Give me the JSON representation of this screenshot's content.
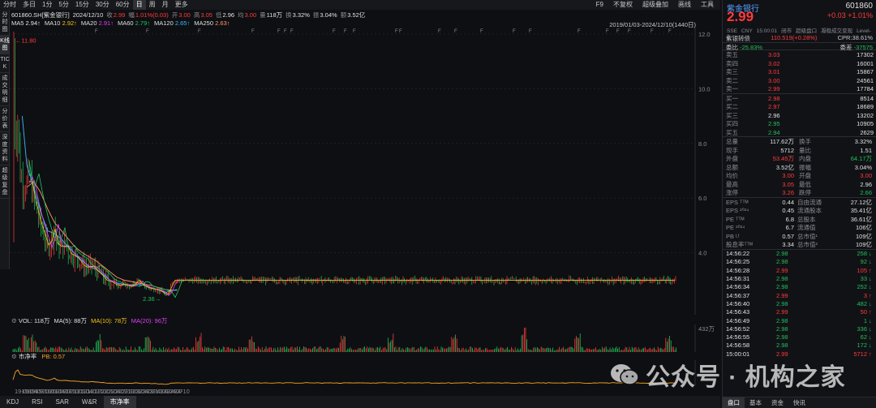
{
  "toolbar": {
    "items": [
      "分时",
      "多日",
      "1分",
      "5分",
      "15分",
      "30分",
      "60分",
      "日",
      "周",
      "月",
      "更多"
    ],
    "active": "日",
    "right": [
      "F9",
      "不复权",
      "超级叠加",
      "画线",
      "工具"
    ]
  },
  "leftbar": [
    "分时图",
    "K线图",
    "TICK",
    "成交明细",
    "分价表",
    "深度资料",
    "超级复盘"
  ],
  "info": {
    "symbol": "601860.SH[紫金银行]",
    "date": "2024/12/10",
    "close_label": "收",
    "close": "2.99",
    "change_label": "幅",
    "change": "1.01%(0.03)",
    "open_label": "开",
    "open": "3.00",
    "high_label": "高",
    "high": "3.05",
    "low_label": "低",
    "low": "2.96",
    "avg_label": "均",
    "avg": "3.00",
    "volume_label": "量",
    "volume": "118万",
    "turnover_label": "换",
    "turnover": "3.32%",
    "amplitude_label": "振",
    "amplitude": "3.04%",
    "amount_label": "额",
    "amount": "3.52亿"
  },
  "ma": [
    {
      "label": "MA5",
      "value": "2.94",
      "color": "#e8e8e8"
    },
    {
      "label": "MA10",
      "value": "2.92",
      "color": "#f5c518"
    },
    {
      "label": "MA20",
      "value": "2.91",
      "color": "#e040fb"
    },
    {
      "label": "MA60",
      "value": "2.79",
      "color": "#21c45e"
    },
    {
      "label": "MA120",
      "value": "2.65",
      "color": "#3db8ff"
    },
    {
      "label": "MA250",
      "value": "2.63",
      "color": "#ff9966"
    }
  ],
  "range_label": "2019/01/03-2024/12/10(1440日)",
  "annotations": {
    "high": "11.80",
    "low": "2.36"
  },
  "vol": {
    "header": "VOL: 118万",
    "ma5": "MA(5): 88万",
    "ma10": "MA(10): 78万",
    "ma20": "MA(20): 96万",
    "axis_max": "432万"
  },
  "pb": {
    "header": "市净率",
    "value": "PB: 0.57"
  },
  "bottom_tabs": [
    "KDJ",
    "RSI",
    "SAR",
    "W&R",
    "市净率"
  ],
  "bottom_active": "市净率",
  "colors": {
    "up": "#ff3b3b",
    "down": "#20c05a",
    "accent": "#5aa0ff"
  },
  "chart_data": {
    "type": "line",
    "title": "",
    "x": [
      "19-07",
      "19-10",
      "20-01",
      "20-04",
      "20-07",
      "20-10",
      "21-01",
      "21-04",
      "21-07",
      "21-10",
      "22-01",
      "22-04",
      "22-07",
      "22-10",
      "23-01",
      "23-04",
      "23-07",
      "23-10",
      "24-01",
      "24-04",
      "24-07",
      "24-10"
    ],
    "x_ticks": [
      "19-01",
      "19-04",
      "19-07",
      "19-10",
      "20-01",
      "20-04",
      "20-07",
      "20-10",
      "21-01",
      "21-04",
      "21-07",
      "21-10",
      "22-01",
      "22-04",
      "22-07",
      "22-10",
      "23-01",
      "23-04",
      "23-07",
      "23-10",
      "24-01",
      "24-04",
      "24-07",
      "24-10"
    ],
    "y_ticks": [
      "12.0",
      "10.0",
      "8.0",
      "6.0",
      "4.0"
    ],
    "ylim": [
      2.0,
      12.0
    ],
    "price_points": [
      [
        "19-01",
        4.5
      ],
      [
        "19-01b",
        11.8
      ],
      [
        "19-02",
        8.0
      ],
      [
        "19-03",
        9.0
      ],
      [
        "19-04",
        7.0
      ],
      [
        "19-05",
        6.6
      ],
      [
        "19-07",
        6.5
      ],
      [
        "19-08",
        6.9
      ],
      [
        "19-10",
        6.0
      ],
      [
        "19-12",
        5.3
      ],
      [
        "20-01",
        5.0
      ],
      [
        "20-03",
        4.5
      ],
      [
        "20-04",
        4.2
      ],
      [
        "20-06",
        4.6
      ],
      [
        "20-07",
        5.1
      ],
      [
        "20-08",
        4.3
      ],
      [
        "20-10",
        4.2
      ],
      [
        "20-12",
        4.3
      ],
      [
        "21-01",
        4.0
      ],
      [
        "21-03",
        3.9
      ],
      [
        "21-05",
        3.8
      ],
      [
        "21-07",
        3.55
      ],
      [
        "21-09",
        3.45
      ],
      [
        "21-11",
        3.55
      ],
      [
        "22-01",
        3.35
      ],
      [
        "22-03",
        3.2
      ],
      [
        "22-05",
        3.0
      ],
      [
        "22-07",
        2.95
      ],
      [
        "22-10",
        2.8
      ],
      [
        "23-01",
        2.85
      ],
      [
        "23-04",
        2.75
      ],
      [
        "23-07",
        3.0
      ],
      [
        "23-09",
        2.8
      ],
      [
        "23-12",
        2.7
      ],
      [
        "24-03",
        2.65
      ],
      [
        "24-06",
        2.55
      ],
      [
        "24-07",
        2.36
      ],
      [
        "24-09",
        2.75
      ],
      [
        "24-10",
        3.0
      ],
      [
        "24-12",
        2.99
      ]
    ],
    "ma250_points": [
      [
        "19-07",
        6.4
      ],
      [
        "19-10",
        6.6
      ],
      [
        "20-01",
        6.2
      ],
      [
        "20-04",
        5.6
      ],
      [
        "20-07",
        5.1
      ],
      [
        "20-10",
        4.8
      ],
      [
        "21-01",
        4.5
      ],
      [
        "21-04",
        4.2
      ],
      [
        "21-07",
        4.0
      ],
      [
        "21-10",
        3.85
      ],
      [
        "22-01",
        3.7
      ],
      [
        "22-04",
        3.5
      ],
      [
        "22-07",
        3.3
      ],
      [
        "22-10",
        3.1
      ],
      [
        "23-01",
        3.0
      ],
      [
        "23-04",
        2.95
      ],
      [
        "23-07",
        2.9
      ],
      [
        "23-10",
        2.85
      ],
      [
        "24-01",
        2.8
      ],
      [
        "24-04",
        2.72
      ],
      [
        "24-07",
        2.65
      ],
      [
        "24-10",
        2.63
      ],
      [
        "24-12",
        2.63
      ]
    ],
    "ma120_points": [
      [
        "19-05",
        9.0
      ],
      [
        "19-07",
        7.2
      ],
      [
        "19-10",
        6.4
      ],
      [
        "20-01",
        5.5
      ],
      [
        "20-04",
        4.8
      ],
      [
        "20-07",
        4.7
      ],
      [
        "20-10",
        4.5
      ],
      [
        "21-01",
        4.2
      ],
      [
        "21-04",
        3.95
      ],
      [
        "21-07",
        3.7
      ],
      [
        "21-10",
        3.5
      ],
      [
        "22-01",
        3.4
      ],
      [
        "22-04",
        3.2
      ],
      [
        "22-07",
        3.0
      ],
      [
        "22-10",
        2.9
      ],
      [
        "23-01",
        2.85
      ],
      [
        "23-04",
        2.8
      ],
      [
        "23-07",
        2.85
      ],
      [
        "23-10",
        2.8
      ],
      [
        "24-01",
        2.7
      ],
      [
        "24-04",
        2.65
      ],
      [
        "24-07",
        2.55
      ],
      [
        "24-10",
        2.62
      ],
      [
        "24-12",
        2.65
      ]
    ],
    "vol_axis_max": "432万",
    "pb_value": 0.57
  },
  "panel": {
    "name": "紫金银行",
    "code": "601860",
    "price": "2.99",
    "change": "+0.03",
    "pct": "+1.01%",
    "sub": [
      "SSE",
      "CNY",
      "15:00:01",
      "闭市",
      "超级盘口",
      "凝稳成交变现",
      "Level-2"
    ],
    "conv_label": "紫银转债",
    "conv_value": "110.519(+0.28%)",
    "conv_prem_label": "CPR:38.61%",
    "ratio_label": "委比",
    "ratio_value": "-25.83%",
    "diff_label": "委差",
    "diff_value": "-37575",
    "asks": [
      {
        "label": "卖五",
        "price": "3.03",
        "qty": "17302"
      },
      {
        "label": "卖四",
        "price": "3.02",
        "qty": "16001"
      },
      {
        "label": "卖三",
        "price": "3.01",
        "qty": "15867"
      },
      {
        "label": "卖二",
        "price": "3.00",
        "qty": "24561"
      },
      {
        "label": "卖一",
        "price": "2.99",
        "qty": "17784"
      }
    ],
    "bids": [
      {
        "label": "买一",
        "price": "2.98",
        "qty": "8514"
      },
      {
        "label": "买二",
        "price": "2.97",
        "qty": "18689"
      },
      {
        "label": "买三",
        "price": "2.96",
        "qty": "13202"
      },
      {
        "label": "买四",
        "price": "2.95",
        "qty": "10905"
      },
      {
        "label": "买五",
        "price": "2.94",
        "qty": "2629"
      }
    ],
    "stats": [
      {
        "l1": "总量",
        "v1": "117.62万",
        "c1": "wt",
        "l2": "换手",
        "v2": "3.32%",
        "c2": "wt"
      },
      {
        "l1": "现手",
        "v1": "5712",
        "c1": "wt",
        "l2": "量比",
        "v2": "1.51",
        "c2": "wt"
      },
      {
        "l1": "外盘",
        "v1": "53.45万",
        "c1": "up",
        "l2": "内盘",
        "v2": "64.17万",
        "c2": "dn"
      },
      {
        "l1": "总额",
        "v1": "3.52亿",
        "c1": "wt",
        "l2": "振幅",
        "v2": "3.04%",
        "c2": "wt"
      },
      {
        "l1": "均价",
        "v1": "3.00",
        "c1": "up",
        "l2": "开盘",
        "v2": "3.00",
        "c2": "up"
      },
      {
        "l1": "最高",
        "v1": "3.05",
        "c1": "up",
        "l2": "最低",
        "v2": "2.96",
        "c2": "wt"
      },
      {
        "l1": "涨停",
        "v1": "3.26",
        "c1": "up",
        "l2": "跌停",
        "v2": "2.66",
        "c2": "dn"
      }
    ],
    "fund": [
      {
        "l1": "EPS ᵀᵀᴹ",
        "v1": "0.44",
        "l2": "自由流通",
        "v2": "27.12亿"
      },
      {
        "l1": "EPS ²⁰²⁴",
        "v1": "0.45",
        "l2": "流通股本",
        "v2": "35.41亿"
      },
      {
        "l1": "PE ᵀᵀᴹ",
        "v1": "6.8",
        "l2": "总股本",
        "v2": "36.61亿"
      },
      {
        "l1": "PE ²⁰²⁴",
        "v1": "6.7",
        "l2": "流通值",
        "v2": "106亿"
      },
      {
        "l1": "PB ᴸᶠ",
        "v1": "0.57",
        "l2": "总市值¹",
        "v2": "109亿"
      },
      {
        "l1": "股息率ᵀᵀᴹ",
        "v1": "3.34",
        "l2": "总市值²",
        "v2": "109亿"
      }
    ],
    "ticks": [
      {
        "t": "14:56:22",
        "p": "2.98",
        "v": "258",
        "c": "dn"
      },
      {
        "t": "14:56:25",
        "p": "2.98",
        "v": "92",
        "c": "dn"
      },
      {
        "t": "14:56:28",
        "p": "2.99",
        "v": "105",
        "c": "up"
      },
      {
        "t": "14:56:31",
        "p": "2.98",
        "v": "33",
        "c": "dn"
      },
      {
        "t": "14:56:34",
        "p": "2.98",
        "v": "252",
        "c": "dn"
      },
      {
        "t": "14:56:37",
        "p": "2.99",
        "v": "3",
        "c": "up"
      },
      {
        "t": "14:56:40",
        "p": "2.98",
        "v": "482",
        "c": "dn"
      },
      {
        "t": "14:56:43",
        "p": "2.99",
        "v": "50",
        "c": "up"
      },
      {
        "t": "14:56:49",
        "p": "2.98",
        "v": "1",
        "c": "dn"
      },
      {
        "t": "14:56:52",
        "p": "2.98",
        "v": "336",
        "c": "dn"
      },
      {
        "t": "14:56:55",
        "p": "2.98",
        "v": "62",
        "c": "dn"
      },
      {
        "t": "14:56:58",
        "p": "2.98",
        "v": "172",
        "c": "dn"
      },
      {
        "t": "15:00:01",
        "p": "2.99",
        "v": "5712",
        "c": "up"
      }
    ],
    "tabs": [
      "盘口",
      "基本",
      "资金",
      "快讯"
    ],
    "tab_active": "盘口"
  },
  "watermark": "公众号 · 机构之家"
}
